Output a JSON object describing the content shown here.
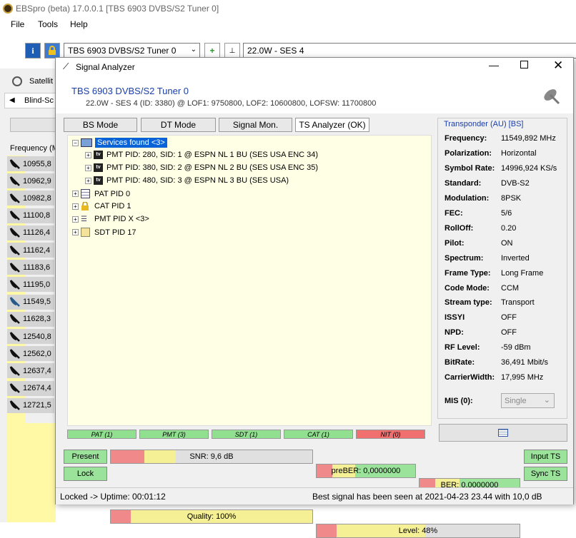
{
  "app": {
    "title": "EBSpro (beta) 17.0.0.1 [TBS 6903 DVBS/S2 Tuner 0]"
  },
  "menu": [
    "File",
    "Tools",
    "Help"
  ],
  "toolbar": {
    "tuner": "TBS 6903 DVBS/S2 Tuner 0",
    "satellite": "22.0W - SES 4"
  },
  "left": {
    "tab_satellite": "Satellit",
    "tab_blind": "Blind-Sc",
    "freq_header": "Frequency (M",
    "freqs": [
      "10955,8",
      "10962,9",
      "10982,8",
      "11100,8",
      "11126,4",
      "11162,4",
      "11183,6",
      "11195,0",
      "11549,5",
      "11628,3",
      "12540,8",
      "12562,0",
      "12637,4",
      "12674,4",
      "12721,5"
    ]
  },
  "dialog": {
    "title": "Signal Analyzer",
    "tuner": "TBS 6903 DVBS/S2 Tuner 0",
    "info": "22.0W - SES 4 (ID: 3380) @ LOF1: 9750800, LOF2: 10600800, LOFSW: 11700800",
    "tabs": [
      "BS Mode",
      "DT Mode",
      "Signal Mon.",
      "TS Analyzer (OK)"
    ],
    "tree": {
      "root": "Services found <3>",
      "services": [
        "PMT PID: 280, SID: 1 @ ESPN NL 1 BU (SES USA ENC 34)",
        "PMT PID: 380, SID: 2 @ ESPN NL 2 BU (SES USA ENC 35)",
        "PMT PID: 480, SID: 3 @ ESPN NL 3 BU (SES USA)"
      ],
      "pat": "PAT PID 0",
      "cat": "CAT PID 1",
      "pmt": "PMT PID X <3>",
      "sdt": "SDT PID 17"
    },
    "transponder": {
      "title": "Transponder (AU) [BS]",
      "rows": [
        {
          "k": "Frequency:",
          "v": "11549,892 MHz"
        },
        {
          "k": "Polarization:",
          "v": "Horizontal"
        },
        {
          "k": "Symbol Rate:",
          "v": "14996,924 KS/s"
        },
        {
          "k": "Standard:",
          "v": "DVB-S2"
        },
        {
          "k": "Modulation:",
          "v": "8PSK"
        },
        {
          "k": "FEC:",
          "v": "5/6"
        },
        {
          "k": "RollOff:",
          "v": "0.20"
        },
        {
          "k": "Pilot:",
          "v": "ON"
        },
        {
          "k": "Spectrum:",
          "v": "Inverted"
        },
        {
          "k": "Frame Type:",
          "v": "Long Frame"
        },
        {
          "k": "Code Mode:",
          "v": "CCM"
        },
        {
          "k": "Stream type:",
          "v": "Transport"
        },
        {
          "k": "ISSYI",
          "v": "OFF"
        },
        {
          "k": "NPD:",
          "v": "OFF"
        },
        {
          "k": "RF Level:",
          "v": "-59 dBm"
        },
        {
          "k": "BitRate:",
          "v": "36,491 Mbit/s"
        },
        {
          "k": "CarrierWidth:",
          "v": "17,995 MHz"
        }
      ],
      "mis_label": "MIS (0):",
      "mis_value": "Single"
    },
    "tables": [
      {
        "label": "PAT (1)",
        "color": "#90e090"
      },
      {
        "label": "PMT (3)",
        "color": "#90e090"
      },
      {
        "label": "SDT (1)",
        "color": "#90e090"
      },
      {
        "label": "CAT (1)",
        "color": "#90e090"
      },
      {
        "label": "NIT (0)",
        "color": "#f07070"
      }
    ],
    "buttons": {
      "present": "Present",
      "lock": "Lock",
      "input_ts": "Input TS",
      "sync_ts": "Sync TS"
    },
    "meters": {
      "snr": "SNR: 9,6 dB",
      "preber": "preBER: 0,0000000",
      "ber": "BER: 0,0000000",
      "quality": "Quality: 100%",
      "level": "Level: 48%",
      "quality_fraction": 1.0,
      "level_fraction": 0.48
    },
    "status_left": "Locked -> Uptime: 00:01:12",
    "status_right": "Best signal has been seen at 2021-04-23 23.44 with 10,0 dB"
  }
}
